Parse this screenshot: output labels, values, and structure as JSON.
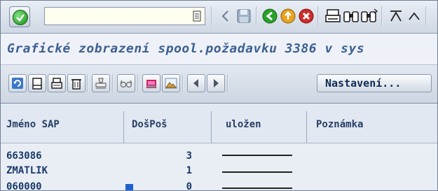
{
  "toolbar": {
    "command_field": {
      "value": "",
      "placeholder": ""
    }
  },
  "title": "Grafické zobrazení spool.požadavku 3386 v sys",
  "app_toolbar": {
    "settings_button_label": "Nastavení..."
  },
  "table": {
    "columns": [
      "Jméno SAP",
      "DošPoš",
      "uložen",
      "Poznámka"
    ],
    "rows": [
      {
        "name": "663086",
        "dospos": "3"
      },
      {
        "name": "ZMATLIK",
        "dospos": "1"
      },
      {
        "name": "060000",
        "dospos": "0"
      }
    ]
  }
}
